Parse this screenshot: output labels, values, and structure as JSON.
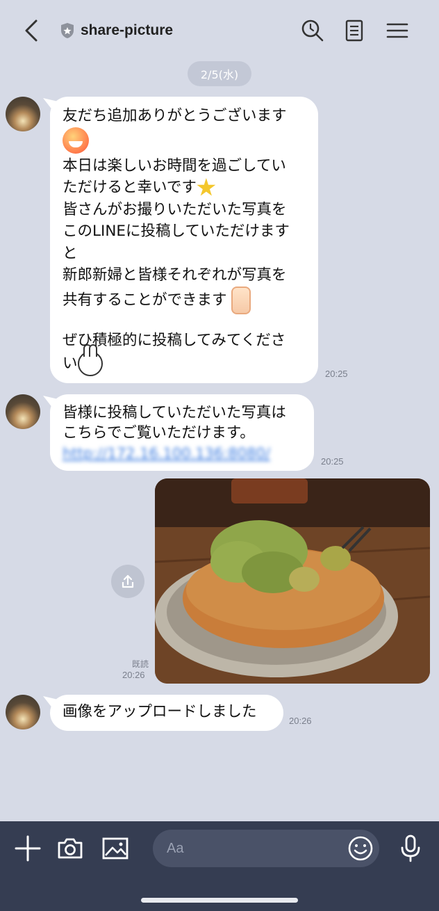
{
  "header": {
    "title": "share-picture"
  },
  "date_label": "2/5(水)",
  "messages": {
    "m1": {
      "l1": "友だち追加ありがとうございます",
      "l2": "本日は楽しいお時間を過ごしてい",
      "l3": "ただけると幸いです",
      "l4": "皆さんがお撮りいただいた写真を",
      "l5": "このLINEに投稿していただけます",
      "l6": "と",
      "l7": "新郎新婦と皆様それぞれが写真を",
      "l8": "共有することができます",
      "l9": "ぜひ積極的に投稿してみてくださ",
      "l10": "い",
      "time": "20:25"
    },
    "m2": {
      "l1": "皆様に投稿していただいた写真は",
      "l2": "こちらでご覧いただけます。",
      "link": "http://172.16.100.136:8080/",
      "time": "20:25"
    },
    "m3": {
      "read": "既読",
      "time": "20:26"
    },
    "m4": {
      "text": "画像をアップロードしました",
      "time": "20:26"
    }
  },
  "input": {
    "placeholder": "Aa"
  },
  "colors": {
    "background": "#d6dae6",
    "bottom_bar": "#353d52",
    "link": "#3a7be0"
  }
}
